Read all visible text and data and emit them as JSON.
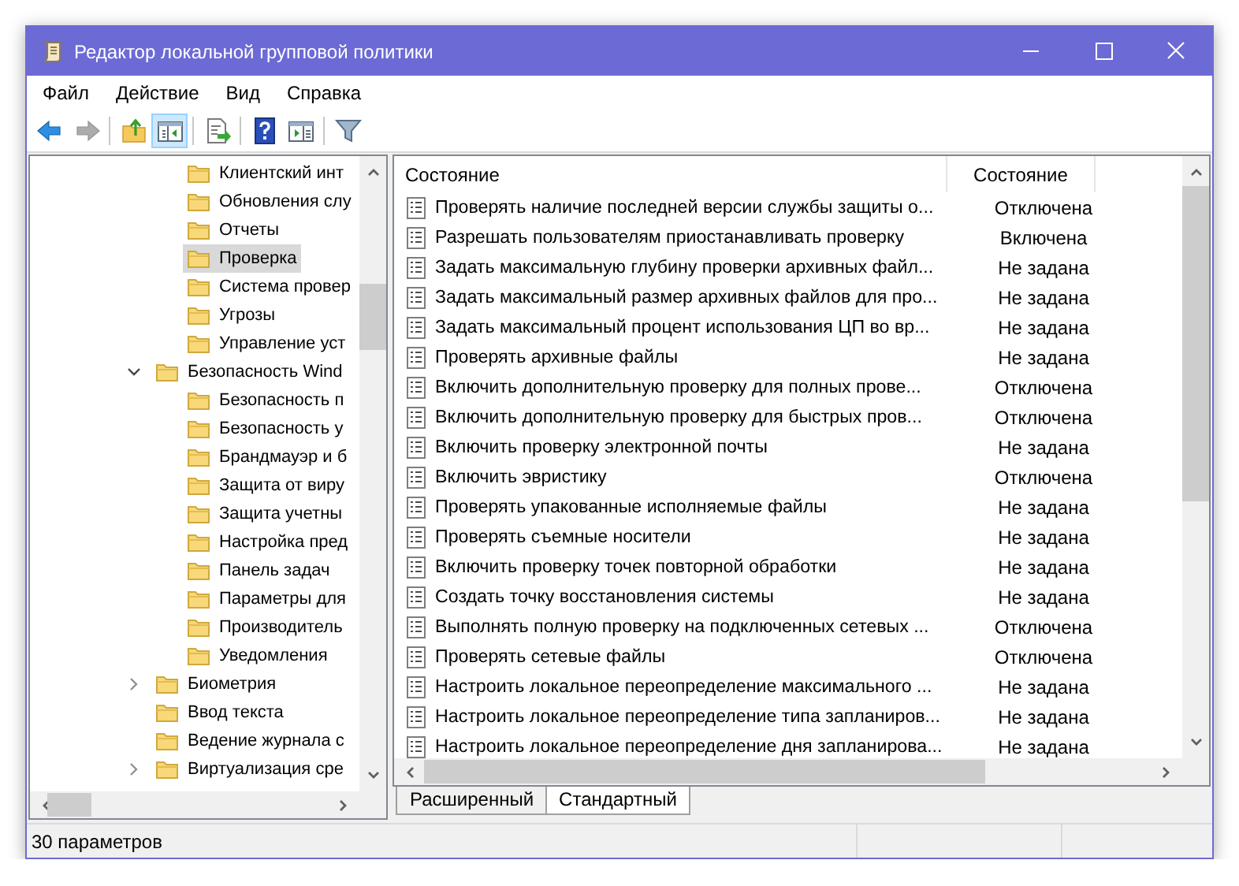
{
  "window": {
    "title": "Редактор локальной групповой политики"
  },
  "menu": [
    "Файл",
    "Действие",
    "Вид",
    "Справка"
  ],
  "toolbar": [
    {
      "kind": "back",
      "disabled": false,
      "pressed": false
    },
    {
      "kind": "forward",
      "disabled": true,
      "pressed": false
    },
    {
      "kind": "separator"
    },
    {
      "kind": "up",
      "disabled": false,
      "pressed": false
    },
    {
      "kind": "tree",
      "disabled": false,
      "pressed": true
    },
    {
      "kind": "separator"
    },
    {
      "kind": "export",
      "disabled": false,
      "pressed": false
    },
    {
      "kind": "separator"
    },
    {
      "kind": "help",
      "disabled": false,
      "pressed": false
    },
    {
      "kind": "pane",
      "disabled": false,
      "pressed": false
    },
    {
      "kind": "separator"
    },
    {
      "kind": "filter",
      "disabled": false,
      "pressed": false
    }
  ],
  "tree": {
    "items": [
      {
        "children": [
          {
            "label": "Клиентский инт",
            "selected": false
          },
          {
            "label": "Обновления слу",
            "selected": false
          },
          {
            "label": "Отчеты",
            "selected": false
          },
          {
            "label": "Проверка",
            "selected": true
          },
          {
            "label": "Система провер",
            "selected": false
          },
          {
            "label": "Угрозы",
            "selected": false
          },
          {
            "label": "Управление уст",
            "selected": false
          }
        ]
      },
      {
        "label": "Безопасность Wind",
        "selected": false,
        "expanded": true,
        "children": [
          {
            "label": "Безопасность п",
            "selected": false
          },
          {
            "label": "Безопасность у",
            "selected": false
          },
          {
            "label": "Брандмауэр и б",
            "selected": false
          },
          {
            "label": "Защита от виру",
            "selected": false
          },
          {
            "label": "Защита учетны",
            "selected": false
          },
          {
            "label": "Настройка пред",
            "selected": false
          },
          {
            "label": "Панель задач",
            "selected": false
          },
          {
            "label": "Параметры для",
            "selected": false
          },
          {
            "label": "Производитель",
            "selected": false
          },
          {
            "label": "Уведомления",
            "selected": false
          }
        ]
      },
      {
        "label": "Биометрия",
        "selected": false,
        "expanded": false
      },
      {
        "label": "Ввод текста",
        "selected": false
      },
      {
        "label": "Ведение журнала с",
        "selected": false
      },
      {
        "label": "Виртуализация сре",
        "selected": false,
        "expanded": false
      }
    ]
  },
  "list": {
    "columns": [
      "Состояние",
      "Состояние"
    ],
    "rows": [
      {
        "name": "Проверять наличие последней версии службы защиты о...",
        "state": "Отключена"
      },
      {
        "name": "Разрешать пользователям приостанавливать проверку",
        "state": "Включена"
      },
      {
        "name": "Задать максимальную глубину проверки архивных файл...",
        "state": "Не задана"
      },
      {
        "name": "Задать максимальный размер архивных файлов для про...",
        "state": "Не задана"
      },
      {
        "name": "Задать максимальный процент использования ЦП во вр...",
        "state": "Не задана"
      },
      {
        "name": "Проверять архивные файлы",
        "state": "Не задана"
      },
      {
        "name": "Включить дополнительную проверку для полных прове...",
        "state": "Отключена"
      },
      {
        "name": "Включить дополнительную проверку для быстрых пров...",
        "state": "Отключена"
      },
      {
        "name": "Включить проверку электронной почты",
        "state": "Не задана"
      },
      {
        "name": "Включить эвристику",
        "state": "Отключена"
      },
      {
        "name": "Проверять упакованные исполняемые файлы",
        "state": "Не задана"
      },
      {
        "name": "Проверять съемные носители",
        "state": "Не задана"
      },
      {
        "name": "Включить проверку точек повторной обработки",
        "state": "Не задана"
      },
      {
        "name": "Создать точку восстановления системы",
        "state": "Не задана"
      },
      {
        "name": "Выполнять полную проверку на подключенных сетевых ...",
        "state": "Отключена"
      },
      {
        "name": "Проверять сетевые файлы",
        "state": "Отключена"
      },
      {
        "name": "Настроить локальное переопределение максимального ...",
        "state": "Не задана"
      },
      {
        "name": "Настроить локальное переопределение типа запланиров...",
        "state": "Не задана"
      },
      {
        "name": "Настроить локальное переопределение дня запланирова...",
        "state": "Не задана"
      }
    ]
  },
  "tabs": [
    {
      "label": "Расширенный",
      "selected": false
    },
    {
      "label": "Стандартный",
      "selected": true
    }
  ],
  "status_bar": "30 параметров"
}
